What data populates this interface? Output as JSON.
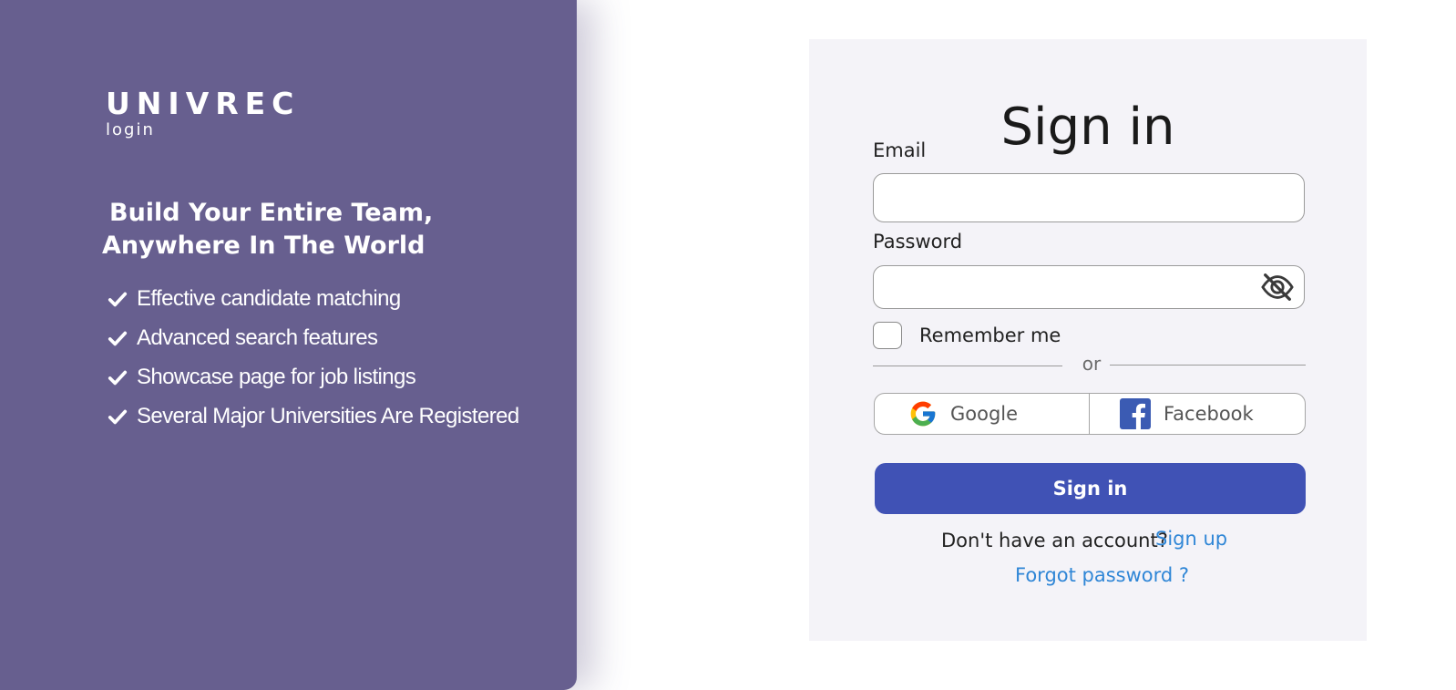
{
  "brand": {
    "title": "UNIVREC",
    "subtitle": "login",
    "headline_line1": "Build Your Entire Team,",
    "headline_line2": "Anywhere In The World",
    "features": [
      "Effective candidate matching",
      "Advanced search features",
      "Showcase page for job listings",
      "Several Major Universities Are Registered"
    ],
    "panel_color": "#675f8f"
  },
  "form": {
    "title": "Sign in",
    "email_label": "Email",
    "email_value": "",
    "password_label": "Password",
    "password_value": "",
    "password_toggle_icon": "eye-off-icon",
    "remember_label": "Remember me",
    "remember_checked": false,
    "divider_text": "or",
    "social": {
      "google_label": "Google",
      "facebook_label": "Facebook"
    },
    "submit_label": "Sign in",
    "no_account_text": "Don't have an account?",
    "signup_label": "Sign up",
    "forgot_label": "Forgot password ?",
    "button_color": "#4052b5",
    "link_color": "#2f86d6"
  }
}
